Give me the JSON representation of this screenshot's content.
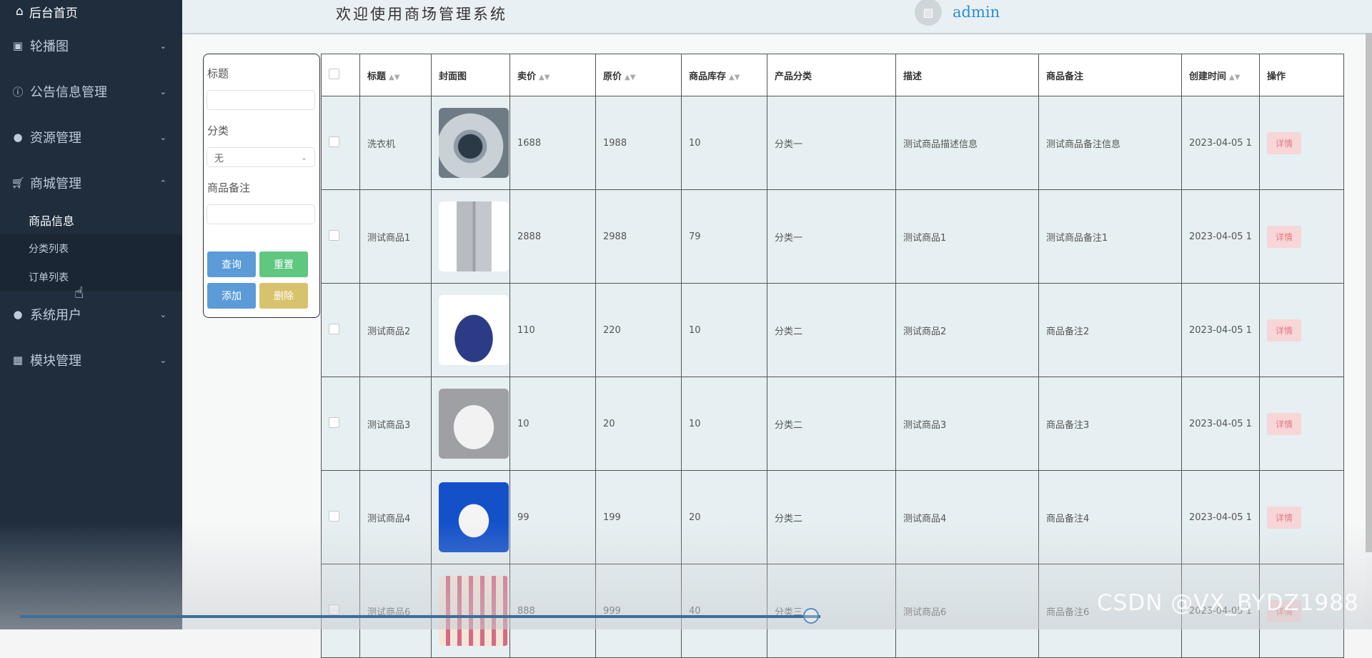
{
  "sidebar": {
    "home": "后台首页",
    "menus": [
      {
        "label": "轮播图"
      },
      {
        "label": "公告信息管理"
      },
      {
        "label": "资源管理"
      },
      {
        "label": "商城管理"
      },
      {
        "label": "系统用户"
      },
      {
        "label": "模块管理"
      }
    ],
    "submenu": [
      "商品信息",
      "分类列表",
      "订单列表"
    ]
  },
  "header": {
    "title": "欢迎使用商场管理系统",
    "username": "admin"
  },
  "filter": {
    "title_label": "标题",
    "category_label": "分类",
    "category_value": "无",
    "remark_label": "商品备注",
    "btn_query": "查询",
    "btn_reset": "重置",
    "btn_add": "添加",
    "btn_delete": "删除"
  },
  "table": {
    "headers": [
      "标题",
      "封面图",
      "卖价",
      "原价",
      "商品库存",
      "产品分类",
      "描述",
      "商品备注",
      "创建时间",
      "操作"
    ],
    "detail_label": "详情",
    "rows": [
      {
        "title": "洗衣机",
        "image": "washing-machine",
        "price": "1688",
        "orig": "1988",
        "stock": "10",
        "category": "分类一",
        "desc": "测试商品描述信息",
        "remark": "测试商品备注信息",
        "created": "2023-04-05 1"
      },
      {
        "title": "测试商品1",
        "image": "refrigerator",
        "price": "2888",
        "orig": "2988",
        "stock": "79",
        "category": "分类一",
        "desc": "测试商品1",
        "remark": "测试商品备注1",
        "created": "2023-04-05 1"
      },
      {
        "title": "测试商品2",
        "image": "handbag",
        "price": "110",
        "orig": "220",
        "stock": "10",
        "category": "分类二",
        "desc": "测试商品2",
        "remark": "商品备注2",
        "created": "2023-04-05 1"
      },
      {
        "title": "测试商品3",
        "image": "t-shirt",
        "price": "10",
        "orig": "20",
        "stock": "10",
        "category": "分类二",
        "desc": "测试商品3",
        "remark": "商品备注3",
        "created": "2023-04-05 1"
      },
      {
        "title": "测试商品4",
        "image": "sneaker",
        "price": "99",
        "orig": "199",
        "stock": "20",
        "category": "分类二",
        "desc": "测试商品4",
        "remark": "商品备注4",
        "created": "2023-04-05 1"
      },
      {
        "title": "测试商品6",
        "image": "lipstick",
        "price": "888",
        "orig": "999",
        "stock": "40",
        "category": "分类三",
        "desc": "测试商品6",
        "remark": "商品备注6",
        "created": "2023-04-05 1"
      }
    ]
  },
  "watermark": "CSDN @VX_BYDZ1988"
}
